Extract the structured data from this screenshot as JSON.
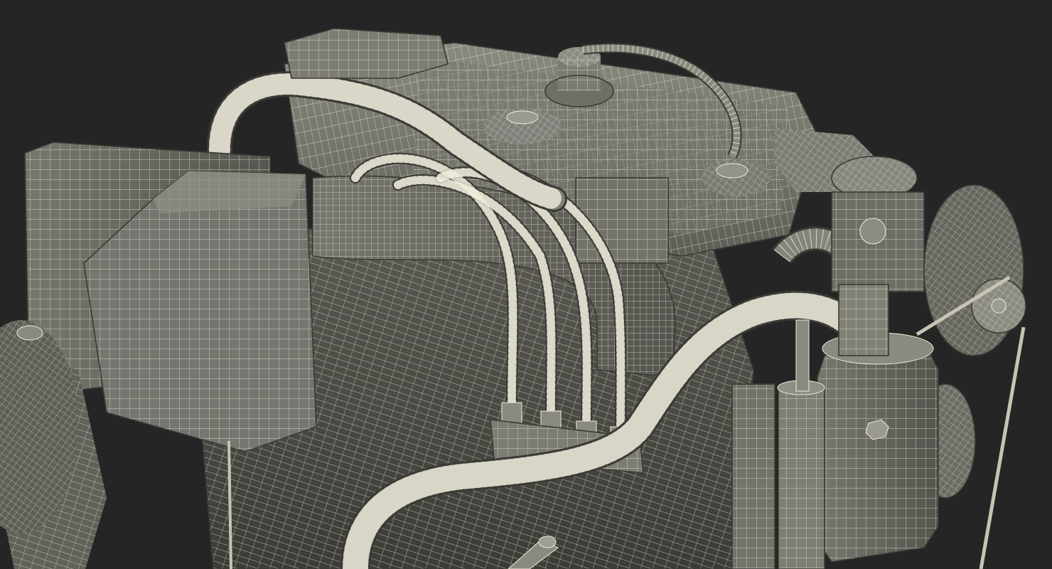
{
  "scene": {
    "subject": "",
    "colors": {
      "background": "#252525",
      "surface": "#6b6b63",
      "surface_light": "#8a8a80",
      "surface_dark": "#4e4e48",
      "wire": "#f0ecdc"
    }
  }
}
